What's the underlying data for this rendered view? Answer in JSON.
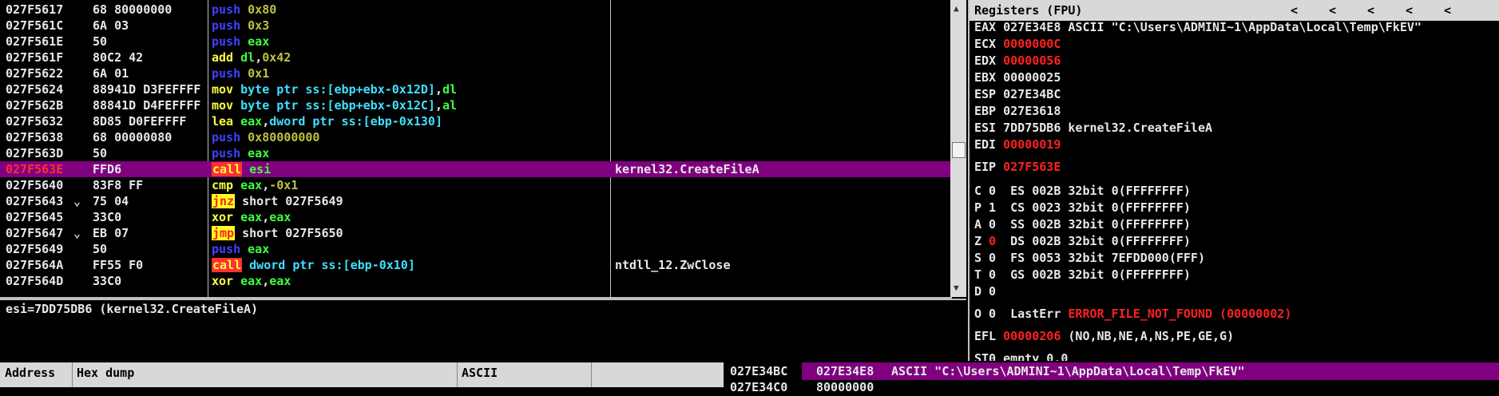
{
  "disasm": {
    "rows": [
      {
        "addr": "027F5617",
        "mark": "",
        "hex": "68 80000000",
        "mn": "push",
        "mnkind": "push",
        "ops": [
          {
            "t": "0x80",
            "k": "num"
          }
        ],
        "comment": "",
        "selected": false
      },
      {
        "addr": "027F561C",
        "mark": "",
        "hex": "6A 03",
        "mn": "push",
        "mnkind": "push",
        "ops": [
          {
            "t": "0x3",
            "k": "num"
          }
        ],
        "comment": "",
        "selected": false
      },
      {
        "addr": "027F561E",
        "mark": "",
        "hex": "50",
        "mn": "push",
        "mnkind": "push",
        "ops": [
          {
            "t": "eax",
            "k": "reg"
          }
        ],
        "comment": "",
        "selected": false
      },
      {
        "addr": "027F561F",
        "mark": "",
        "hex": "80C2 42",
        "mn": "add",
        "mnkind": "add",
        "ops": [
          {
            "t": "dl",
            "k": "reg"
          },
          {
            "t": ",",
            "k": "txt"
          },
          {
            "t": "0x42",
            "k": "num"
          }
        ],
        "comment": "",
        "selected": false
      },
      {
        "addr": "027F5622",
        "mark": "",
        "hex": "6A 01",
        "mn": "push",
        "mnkind": "push",
        "ops": [
          {
            "t": "0x1",
            "k": "num"
          }
        ],
        "comment": "",
        "selected": false
      },
      {
        "addr": "027F5624",
        "mark": "",
        "hex": "88941D D3FEFFFF",
        "mn": "mov",
        "mnkind": "mov",
        "ops": [
          {
            "t": "byte ptr ss:[ebp+ebx-0x12D]",
            "k": "mem"
          },
          {
            "t": ",",
            "k": "txt"
          },
          {
            "t": "dl",
            "k": "reg"
          }
        ],
        "comment": "",
        "selected": false
      },
      {
        "addr": "027F562B",
        "mark": "",
        "hex": "88841D D4FEFFFF",
        "mn": "mov",
        "mnkind": "mov",
        "ops": [
          {
            "t": "byte ptr ss:[ebp+ebx-0x12C]",
            "k": "mem"
          },
          {
            "t": ",",
            "k": "txt"
          },
          {
            "t": "al",
            "k": "reg"
          }
        ],
        "comment": "",
        "selected": false
      },
      {
        "addr": "027F5632",
        "mark": "",
        "hex": "8D85 D0FEFFFF",
        "mn": "lea",
        "mnkind": "lea",
        "ops": [
          {
            "t": "eax",
            "k": "reg"
          },
          {
            "t": ",",
            "k": "txt"
          },
          {
            "t": "dword ptr ss:[ebp-0x130]",
            "k": "mem"
          }
        ],
        "comment": "",
        "selected": false
      },
      {
        "addr": "027F5638",
        "mark": "",
        "hex": "68 00000080",
        "mn": "push",
        "mnkind": "push",
        "ops": [
          {
            "t": "0x80000000",
            "k": "num"
          }
        ],
        "comment": "",
        "selected": false
      },
      {
        "addr": "027F563D",
        "mark": "",
        "hex": "50",
        "mn": "push",
        "mnkind": "push",
        "ops": [
          {
            "t": "eax",
            "k": "reg"
          }
        ],
        "comment": "",
        "selected": false
      },
      {
        "addr": "027F563E",
        "mark": "",
        "hex": "FFD6",
        "mn": "call",
        "mnkind": "callhl",
        "ops": [
          {
            "t": "esi",
            "k": "reg"
          }
        ],
        "comment": "kernel32.CreateFileA",
        "selected": true
      },
      {
        "addr": "027F5640",
        "mark": "",
        "hex": "83F8 FF",
        "mn": "cmp",
        "mnkind": "cmp",
        "ops": [
          {
            "t": "eax",
            "k": "reg"
          },
          {
            "t": ",",
            "k": "txt"
          },
          {
            "t": "-0x1",
            "k": "num"
          }
        ],
        "comment": "",
        "selected": false
      },
      {
        "addr": "027F5643",
        "mark": "⌄",
        "hex": "75 04",
        "mn": "jnz",
        "mnkind": "jmphl",
        "ops": [
          {
            "t": "short 027F5649",
            "k": "txt"
          }
        ],
        "comment": "",
        "selected": false
      },
      {
        "addr": "027F5645",
        "mark": "",
        "hex": "33C0",
        "mn": "xor",
        "mnkind": "xor",
        "ops": [
          {
            "t": "eax",
            "k": "reg"
          },
          {
            "t": ",",
            "k": "txt"
          },
          {
            "t": "eax",
            "k": "reg"
          }
        ],
        "comment": "",
        "selected": false
      },
      {
        "addr": "027F5647",
        "mark": "⌄",
        "hex": "EB 07",
        "mn": "jmp",
        "mnkind": "jmphl",
        "ops": [
          {
            "t": "short 027F5650",
            "k": "txt"
          }
        ],
        "comment": "",
        "selected": false
      },
      {
        "addr": "027F5649",
        "mark": "",
        "hex": "50",
        "mn": "push",
        "mnkind": "push",
        "ops": [
          {
            "t": "eax",
            "k": "reg"
          }
        ],
        "comment": "",
        "selected": false
      },
      {
        "addr": "027F564A",
        "mark": "",
        "hex": "FF55 F0",
        "mn": "call",
        "mnkind": "callhl",
        "ops": [
          {
            "t": "dword ptr ss:[ebp-0x10]",
            "k": "mem"
          }
        ],
        "comment": "ntdll_12.ZwClose",
        "selected": false
      },
      {
        "addr": "027F564D",
        "mark": "",
        "hex": "33C0",
        "mn": "xor",
        "mnkind": "xor",
        "ops": [
          {
            "t": "eax",
            "k": "reg"
          },
          {
            "t": ",",
            "k": "txt"
          },
          {
            "t": "eax",
            "k": "reg"
          }
        ],
        "comment": "",
        "selected": false
      }
    ]
  },
  "info": {
    "line": "esi=7DD75DB6 (kernel32.CreateFileA)"
  },
  "registers": {
    "title": "Registers (FPU)",
    "arrows": [
      "<",
      "<",
      "<",
      "<",
      "<"
    ],
    "lines": [
      {
        "parts": [
          {
            "t": "EAX 027E34E8 ASCII \"C:\\Users\\ADMINI~1\\AppData\\Local\\Temp\\FkEV\"",
            "c": "n"
          }
        ]
      },
      {
        "parts": [
          {
            "t": "ECX ",
            "c": "n"
          },
          {
            "t": "0000000C",
            "c": "r"
          }
        ]
      },
      {
        "parts": [
          {
            "t": "EDX ",
            "c": "n"
          },
          {
            "t": "00000056",
            "c": "r"
          }
        ]
      },
      {
        "parts": [
          {
            "t": "EBX 00000025",
            "c": "n"
          }
        ]
      },
      {
        "parts": [
          {
            "t": "ESP 027E34BC",
            "c": "n"
          }
        ]
      },
      {
        "parts": [
          {
            "t": "EBP 027E3618",
            "c": "n"
          }
        ]
      },
      {
        "parts": [
          {
            "t": "ESI 7DD75DB6 kernel32.CreateFileA",
            "c": "n"
          }
        ]
      },
      {
        "parts": [
          {
            "t": "EDI ",
            "c": "n"
          },
          {
            "t": "00000019",
            "c": "r"
          }
        ]
      },
      {
        "parts": [
          {
            "t": "EIP ",
            "c": "n"
          },
          {
            "t": "027F563E",
            "c": "r"
          }
        ]
      },
      {
        "parts": [
          {
            "t": "C 0  ES 002B 32bit 0(FFFFFFFF)",
            "c": "n"
          }
        ]
      },
      {
        "parts": [
          {
            "t": "P 1  CS 0023 32bit 0(FFFFFFFF)",
            "c": "n"
          }
        ]
      },
      {
        "parts": [
          {
            "t": "A 0  SS 002B 32bit 0(FFFFFFFF)",
            "c": "n"
          }
        ]
      },
      {
        "parts": [
          {
            "t": "Z ",
            "c": "n"
          },
          {
            "t": "0",
            "c": "r"
          },
          {
            "t": "  DS 002B 32bit 0(FFFFFFFF)",
            "c": "n"
          }
        ]
      },
      {
        "parts": [
          {
            "t": "S 0  FS 0053 32bit 7EFDD000(FFF)",
            "c": "n"
          }
        ]
      },
      {
        "parts": [
          {
            "t": "T 0  GS 002B 32bit 0(FFFFFFFF)",
            "c": "n"
          }
        ]
      },
      {
        "parts": [
          {
            "t": "D 0",
            "c": "n"
          }
        ]
      },
      {
        "parts": [
          {
            "t": "O 0  LastErr ",
            "c": "n"
          },
          {
            "t": "ERROR_FILE_NOT_FOUND (00000002)",
            "c": "r"
          }
        ]
      },
      {
        "parts": [
          {
            "t": "EFL ",
            "c": "n"
          },
          {
            "t": "00000206",
            "c": "r"
          },
          {
            "t": " (NO,NB,NE,A,NS,PE,GE,G)",
            "c": "n"
          }
        ]
      },
      {
        "parts": [
          {
            "t": "ST0 empty 0.0",
            "c": "n"
          }
        ]
      }
    ]
  },
  "dump": {
    "col_address": "Address",
    "col_hex": "Hex dump",
    "col_ascii": "ASCII"
  },
  "stack": {
    "addr": "027E34BC",
    "value": "027E34E8",
    "comment": "ASCII \"C:\\Users\\ADMINI~1\\AppData\\Local\\Temp\\FkEV\"",
    "addr2": "027E34C0",
    "value2": "80000000"
  }
}
